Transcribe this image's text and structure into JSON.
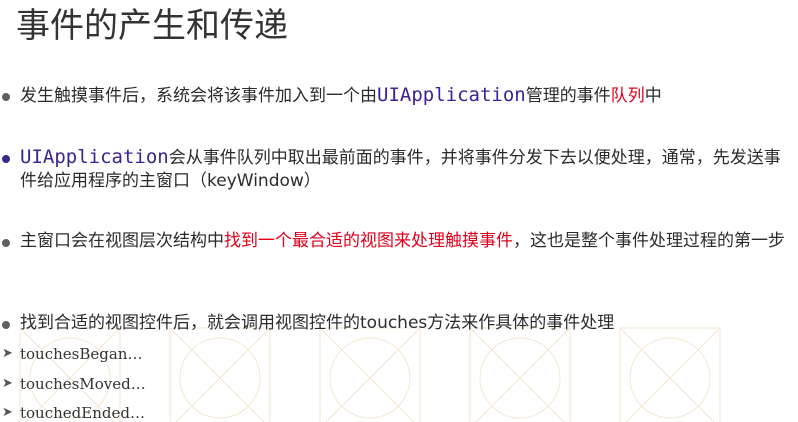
{
  "title": "事件的产生和传递",
  "bullets": [
    {
      "parts": [
        {
          "t": "发生触摸事件后，系统会将该事件加入到一个由",
          "style": "normal"
        },
        {
          "t": "UIApplication",
          "style": "mono"
        },
        {
          "t": "管理的事件",
          "style": "normal"
        },
        {
          "t": "队列",
          "style": "red"
        },
        {
          "t": "中",
          "style": "normal"
        }
      ]
    },
    {
      "parts": [
        {
          "t": "UIApplication",
          "style": "mono"
        },
        {
          "t": "会从事件队列中取出最前面的事件，并将事件分发下去以便处理，通常，先发送事件给应用程序的主窗口（keyWindow）",
          "style": "normal"
        }
      ]
    },
    {
      "parts": [
        {
          "t": "主窗口会在视图层次结构中",
          "style": "normal"
        },
        {
          "t": "找到一个最合适的视图来处理触摸事件",
          "style": "red"
        },
        {
          "t": "，这也是整个事件处理过程的第一步",
          "style": "normal"
        }
      ]
    },
    {
      "parts": [
        {
          "t": "找到合适的视图控件后，就会调用视图控件的touches方法来作具体的事件处理",
          "style": "normal"
        }
      ]
    }
  ],
  "subitems": [
    {
      "label": "touchesBegan…"
    },
    {
      "label": "touchesMoved…"
    },
    {
      "label": "touchedEnded…"
    }
  ],
  "colors": {
    "accent_red": "#e0001b",
    "code_purple": "#3b2394"
  },
  "icons": {
    "bullet": "bullet-dot-icon",
    "subitem": "arrowhead-icon"
  }
}
